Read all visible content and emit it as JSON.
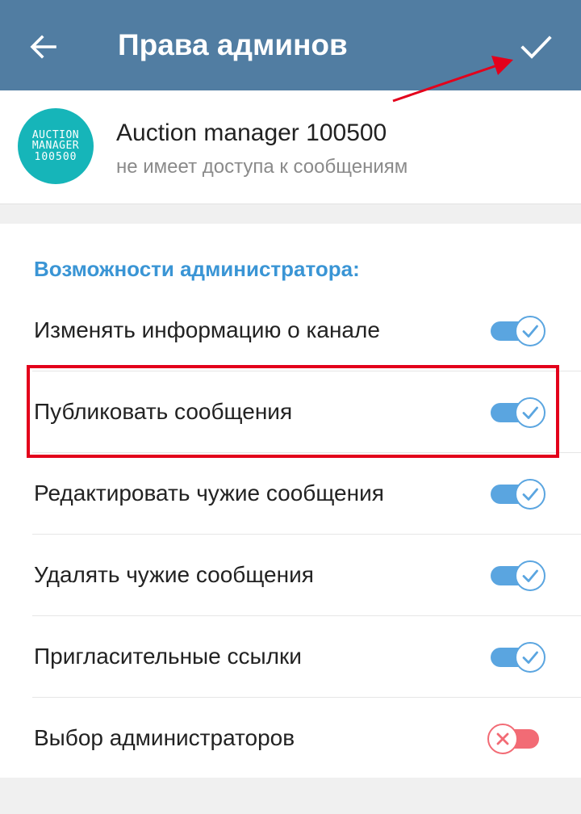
{
  "header": {
    "title": "Права админов",
    "back_icon": "arrow-left-icon",
    "done_icon": "checkmark-icon"
  },
  "profile": {
    "avatar_lines": [
      "AUCTION",
      "MANAGER",
      "100500"
    ],
    "avatar_color": "#16b5b9",
    "name": "Auction manager 100500",
    "status": "не имеет доступа к сообщениям"
  },
  "permissions": {
    "header": "Возможности администратора:",
    "items": [
      {
        "label": "Изменять информацию о канале",
        "enabled": true
      },
      {
        "label": "Публиковать сообщения",
        "enabled": true
      },
      {
        "label": "Редактировать чужие сообщения",
        "enabled": true
      },
      {
        "label": "Удалять чужие сообщения",
        "enabled": true
      },
      {
        "label": "Пригласительные ссылки",
        "enabled": true
      },
      {
        "label": "Выбор администраторов",
        "enabled": false
      }
    ]
  },
  "colors": {
    "header_bg": "#517da2",
    "accent": "#3a95d5",
    "toggle_on": "#5aa5e0",
    "toggle_off": "#f26b75",
    "annotation": "#e3001b"
  }
}
